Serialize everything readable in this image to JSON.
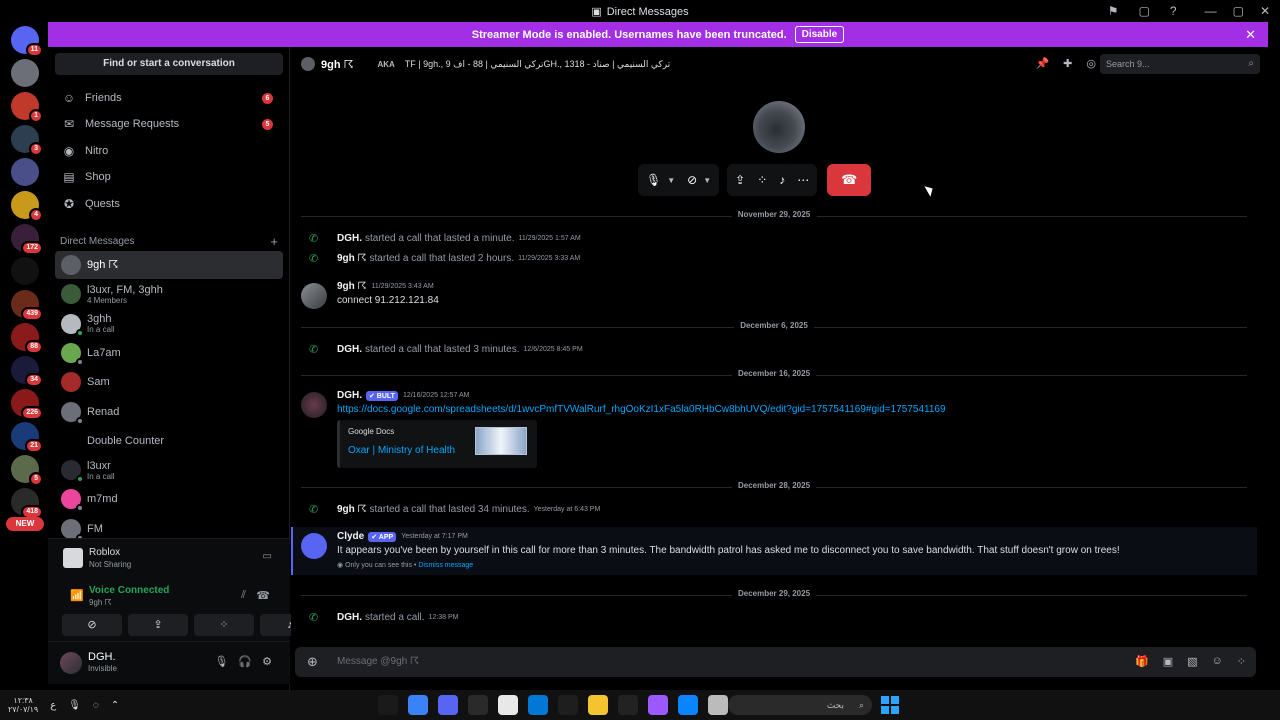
{
  "window": {
    "title": "Direct Messages"
  },
  "banner": {
    "text": "Streamer Mode is enabled. Usernames have been truncated.",
    "disable_label": "Disable"
  },
  "servers": [
    {
      "badge": "11",
      "color": "#5865f2"
    },
    {
      "badge": "",
      "color": "#6d6f78"
    },
    {
      "badge": "1",
      "color": "#c0392b"
    },
    {
      "badge": "3",
      "color": "#2c3e50"
    },
    {
      "badge": "",
      "color": "#4a4f8a"
    },
    {
      "badge": "4",
      "color": "#c99a1a"
    },
    {
      "badge": "172",
      "color": "#3a1f3a"
    },
    {
      "badge": "",
      "color": "#111"
    },
    {
      "badge": "439",
      "color": "#6b2b1a"
    },
    {
      "badge": "88",
      "color": "#8b1a1a"
    },
    {
      "badge": "34",
      "color": "#1a1a3a"
    },
    {
      "badge": "226",
      "color": "#8a1a1a"
    },
    {
      "badge": "21",
      "color": "#1a3a7a"
    },
    {
      "badge": "5",
      "color": "#5a6a4a"
    },
    {
      "badge": "418",
      "color": "#2a2a2a"
    }
  ],
  "new_pill": "NEW",
  "sidebar": {
    "find_label": "Find or start a conversation",
    "nav": [
      {
        "label": "Friends",
        "count": "6"
      },
      {
        "label": "Message Requests",
        "count": "5"
      },
      {
        "label": "Nitro",
        "count": ""
      },
      {
        "label": "Shop",
        "count": ""
      },
      {
        "label": "Quests",
        "count": ""
      }
    ],
    "dm_header": "Direct Messages",
    "dms": [
      {
        "name": "9gh ☈",
        "sub": "",
        "active": true,
        "color": "#5c5f66",
        "status": ""
      },
      {
        "name": "l3uxr, FM, 3ghh",
        "sub": "4 Members",
        "active": false,
        "color": "#3a5a3a",
        "status": ""
      },
      {
        "name": "3ghh",
        "sub": "In a call",
        "active": false,
        "color": "#b5bac1",
        "status": "#23a55a"
      },
      {
        "name": "La7am",
        "sub": "",
        "active": false,
        "color": "#6aa84f",
        "status": "#80848e"
      },
      {
        "name": "Sam",
        "sub": "",
        "active": false,
        "color": "#a52a2a",
        "status": ""
      },
      {
        "name": "Renad",
        "sub": "",
        "active": false,
        "color": "#6d6f78",
        "status": "#80848e"
      },
      {
        "name": "Double Counter",
        "sub": "",
        "active": false,
        "color": "#000",
        "status": ""
      },
      {
        "name": "l3uxr",
        "sub": "In a call",
        "active": false,
        "color": "#2a2a33",
        "status": "#23a55a"
      },
      {
        "name": "m7md",
        "sub": "",
        "active": false,
        "color": "#eb459e",
        "status": "#80848e"
      },
      {
        "name": "FM",
        "sub": "",
        "active": false,
        "color": "#6d6f78",
        "status": "#80848e"
      }
    ],
    "activity": {
      "title": "Roblox",
      "status": "Not Sharing"
    },
    "voice": {
      "status": "Voice Connected",
      "channel": "9gh ☈"
    },
    "user": {
      "name": "DGH.",
      "status": "Invisible"
    }
  },
  "channel": {
    "name": "9gh ☈",
    "aka_label": "AKA",
    "aka_values": "TF | 9gh., 9 تركي السنيمي | 88 - افGH., 1318 - تركي السنيمي | صناد",
    "search_placeholder": "Search 9..."
  },
  "messages": {
    "date1": "November 29, 2025",
    "call1": {
      "author": "DGH.",
      "text": "started a call that lasted a minute.",
      "ts": "11/29/2025 1:57 AM"
    },
    "call2": {
      "author": "9gh ☈",
      "text": "started a call that lasted 2 hours.",
      "ts": "11/29/2025 3:33 AM"
    },
    "msg1": {
      "author": "9gh ☈",
      "ts": "11/29/2025 3:43 AM",
      "body": "connect 91.212.121.84"
    },
    "date2": "December 6, 2025",
    "call3": {
      "author": "DGH.",
      "text": "started a call that lasted 3 minutes.",
      "ts": "12/6/2025 8:45 PM"
    },
    "date3": "December 16, 2025",
    "msg2": {
      "author": "DGH.",
      "tag": "✔ BULT",
      "ts": "12/16/2025 12:57 AM",
      "link": "https://docs.google.com/spreadsheets/d/1wvcPmfTVWalRurf_rhgOoKzI1xFa5la0RHbCw8bhUVQ/edit?gid=1757541169#gid=1757541169",
      "embed_provider": "Google Docs",
      "embed_title": "Oxar | Ministry of Health"
    },
    "date4": "December 28, 2025",
    "call4": {
      "author": "9gh ☈",
      "text": "started a call that lasted 34 minutes.",
      "ts": "Yesterday at 6:43 PM"
    },
    "clyde": {
      "author": "Clyde",
      "tag": "✔ APP",
      "ts": "Yesterday at 7:17 PM",
      "body": "It appears you've been by yourself in this call for more than 3 minutes. The bandwidth patrol has asked me to disconnect you to save bandwidth. That stuff doesn't grow on trees!",
      "ephemeral": "Only you can see this •",
      "dismiss": "Dismiss message"
    },
    "date5": "December 29, 2025",
    "call5": {
      "author": "DGH.",
      "text": "started a call.",
      "ts": "12:38 PM"
    }
  },
  "composer": {
    "placeholder": "Message @9gh ☈"
  },
  "taskbar": {
    "time": "١٢:٣٨",
    "date": "٢٧/٠٧/١٩",
    "search": "بحث"
  }
}
